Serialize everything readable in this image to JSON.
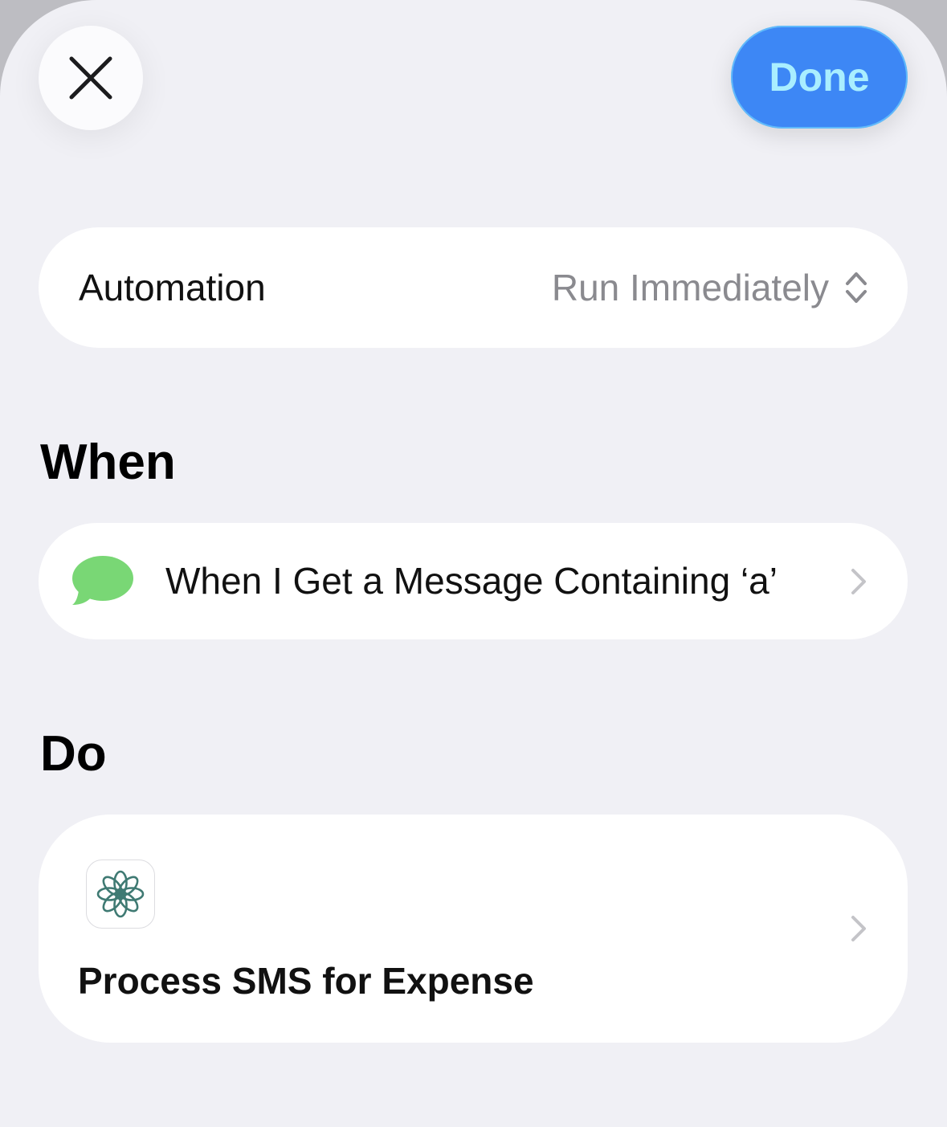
{
  "header": {
    "close_icon": "close-icon",
    "done_label": "Done",
    "done_color": "#3d87f5"
  },
  "automation": {
    "label": "Automation",
    "value": "Run Immediately",
    "icon": "chevron-up-down-icon"
  },
  "when": {
    "title": "When",
    "trigger": {
      "icon": "message-bubble-icon",
      "icon_color": "#79d775",
      "label": "When I Get a Message Containing ‘a’"
    }
  },
  "do": {
    "title": "Do",
    "action": {
      "icon": "shortcut-flower-icon",
      "label": "Process SMS for Expense"
    }
  }
}
